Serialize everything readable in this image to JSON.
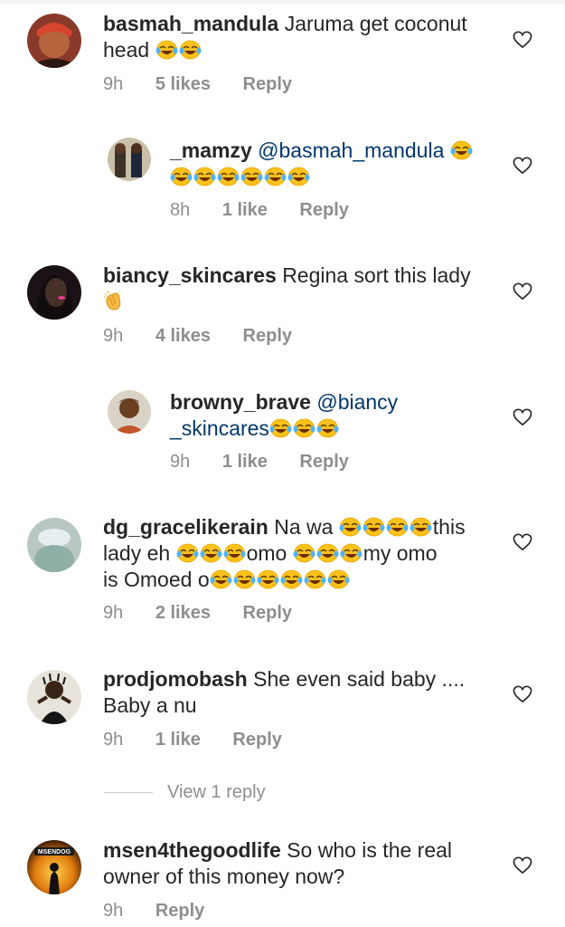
{
  "comments": [
    {
      "username": "basmah_mandula",
      "text_line1": "Jaruma get coconut",
      "text_line2": "head",
      "time": "9h",
      "likes": "5 likes",
      "reply": "Reply"
    },
    {
      "username": "_mamzy",
      "mention": "@basmah_mandula",
      "time": "8h",
      "likes": "1 like",
      "reply": "Reply"
    },
    {
      "username": "biancy_skincares",
      "text_line1": "Regina sort this lady",
      "time": "9h",
      "likes": "4 likes",
      "reply": "Reply"
    },
    {
      "username": "browny_brave",
      "mention_line1": "@biancy",
      "mention_line2": "_skincares",
      "time": "9h",
      "likes": "1 like",
      "reply": "Reply"
    },
    {
      "username": "dg_gracelikerain",
      "t1": "Na wa",
      "t2": "this",
      "t3": "lady eh",
      "t4": "omo",
      "t5": "my omo",
      "t6": "is Omoed o",
      "time": "9h",
      "likes": "2 likes",
      "reply": "Reply"
    },
    {
      "username": "prodjomobash",
      "text_line1": "She even said baby ....",
      "text_line2": "Baby a nu",
      "time": "9h",
      "likes": "1 like",
      "reply": "Reply",
      "view_replies": "View 1 reply"
    },
    {
      "username": "msen4thegoodlife",
      "text_line1": "So who is the real",
      "text_line2": "owner of this money now?",
      "avatar_label": "MSENDOG",
      "time": "9h",
      "reply": "Reply"
    }
  ],
  "icons": {
    "like": "heart-outline-icon",
    "emoji_laugh": "face-with-tears-of-joy-icon",
    "emoji_clap": "clapping-hands-icon"
  },
  "colors": {
    "username": "#262626",
    "mention": "#00376b",
    "meta": "#8e8e8e"
  }
}
